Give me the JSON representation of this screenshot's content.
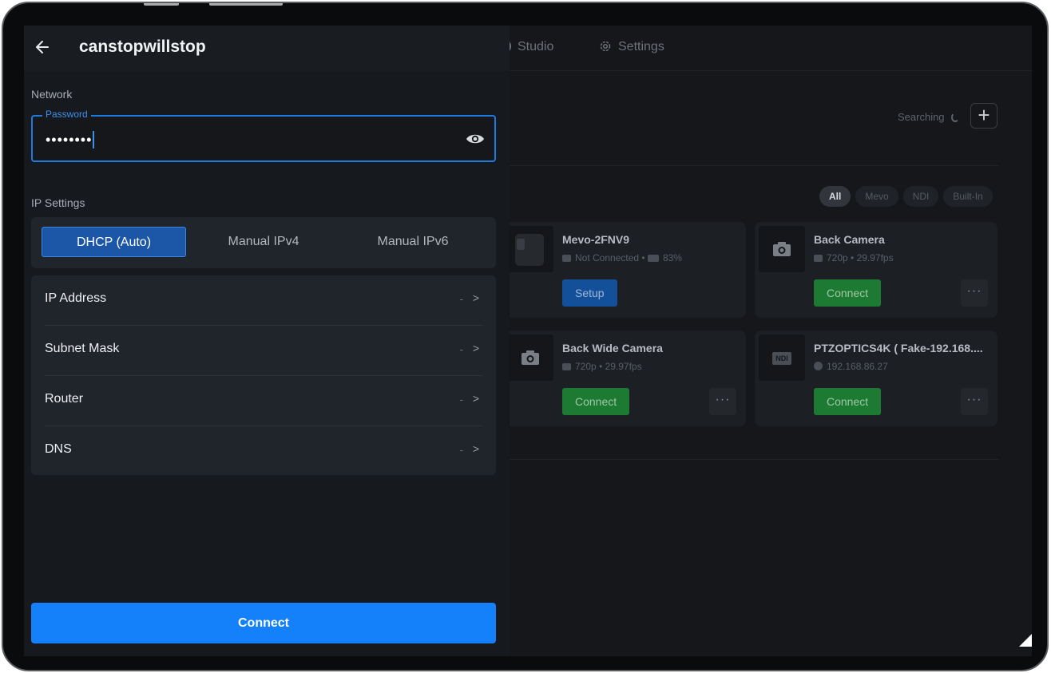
{
  "panel": {
    "title": "canstopwillstop",
    "network_label": "Network",
    "password": {
      "label": "Password",
      "value": "••••••••"
    },
    "ip_settings_label": "IP Settings",
    "modes": [
      "DHCP (Auto)",
      "Manual IPv4",
      "Manual IPv6"
    ],
    "selected_mode": "DHCP (Auto)",
    "rows": [
      {
        "label": "IP Address",
        "value": "-"
      },
      {
        "label": "Subnet Mask",
        "value": "-"
      },
      {
        "label": "Router",
        "value": "-"
      },
      {
        "label": "DNS",
        "value": "-"
      }
    ],
    "connect_label": "Connect"
  },
  "background": {
    "tabs": {
      "studio": "Studio",
      "settings": "Settings"
    },
    "searching": "Searching",
    "filters": [
      "All",
      "Mevo",
      "NDI",
      "Built-In"
    ],
    "active_filter": "All",
    "cards": [
      {
        "name": "Mevo-2FNV9",
        "status": "Not Connected",
        "battery": "83%",
        "action": "Setup"
      },
      {
        "name": "Back Camera",
        "spec": "720p • 29.97fps",
        "action": "Connect"
      },
      {
        "name": "Back Wide Camera",
        "spec": "720p • 29.97fps",
        "action": "Connect"
      },
      {
        "name": "PTZOPTICS4K ( Fake-192.168....",
        "spec": "192.168.86.27",
        "action": "Connect",
        "badge": "NDI"
      }
    ]
  },
  "icons": [
    "back-arrow-icon",
    "eye-icon",
    "chevron-right-icon",
    "gear-icon",
    "camera-icon",
    "plus-icon",
    "spinner-icon",
    "more-icon"
  ],
  "colors": {
    "accent": "#1480f9",
    "focus": "#1f7ae0",
    "connect_green": "#1d7a33",
    "setup_blue": "#14509a"
  }
}
